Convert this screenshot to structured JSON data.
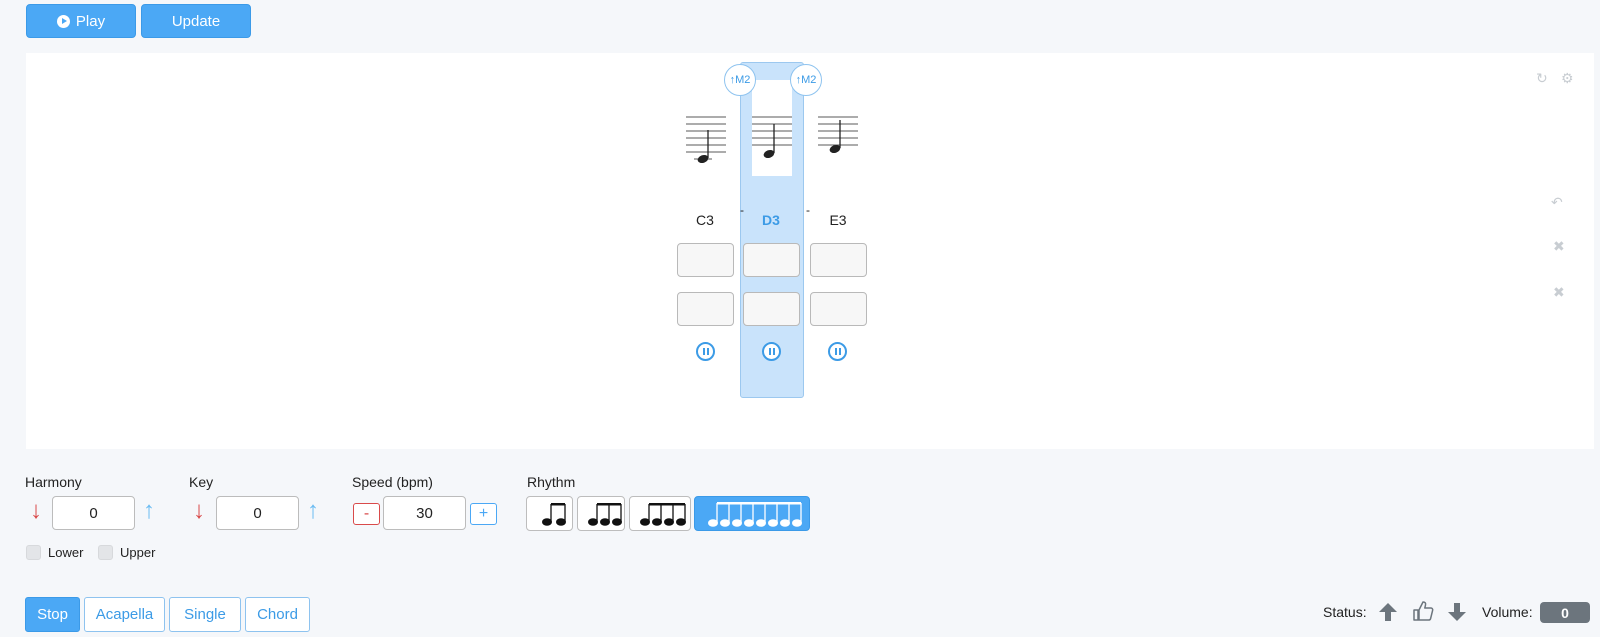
{
  "toolbar": {
    "play_label": "Play",
    "update_label": "Update"
  },
  "intervals": [
    "M2",
    "M2"
  ],
  "notes": [
    {
      "name": "C3",
      "active": false
    },
    {
      "name": "D3",
      "active": true
    },
    {
      "name": "E3",
      "active": false
    }
  ],
  "tie_marks": [
    "-",
    "-"
  ],
  "controls": {
    "harmony_label": "Harmony",
    "harmony_value": "0",
    "key_label": "Key",
    "key_value": "0",
    "speed_label": "Speed (bpm)",
    "speed_value": "30",
    "speed_minus": "-",
    "speed_plus": "+",
    "rhythm_label": "Rhythm",
    "lower_label": "Lower",
    "upper_label": "Upper"
  },
  "rhythm_options": [
    {
      "icon": "two-eighth-notes-icon",
      "active": false
    },
    {
      "icon": "three-eighth-notes-icon",
      "active": false
    },
    {
      "icon": "four-eighth-notes-icon",
      "active": false
    },
    {
      "icon": "eight-eighth-notes-icon",
      "active": true
    }
  ],
  "modes": [
    {
      "label": "Stop",
      "active": true
    },
    {
      "label": "Acapella",
      "active": false
    },
    {
      "label": "Single",
      "active": false
    },
    {
      "label": "Chord",
      "active": false
    }
  ],
  "status": {
    "label": "Status:",
    "volume_label": "Volume:",
    "volume_value": "0"
  },
  "colors": {
    "accent": "#4ba8f5",
    "down_arrow": "#d94a4a",
    "up_arrow": "#6cbcf2",
    "highlight": "#c9e3fb"
  }
}
